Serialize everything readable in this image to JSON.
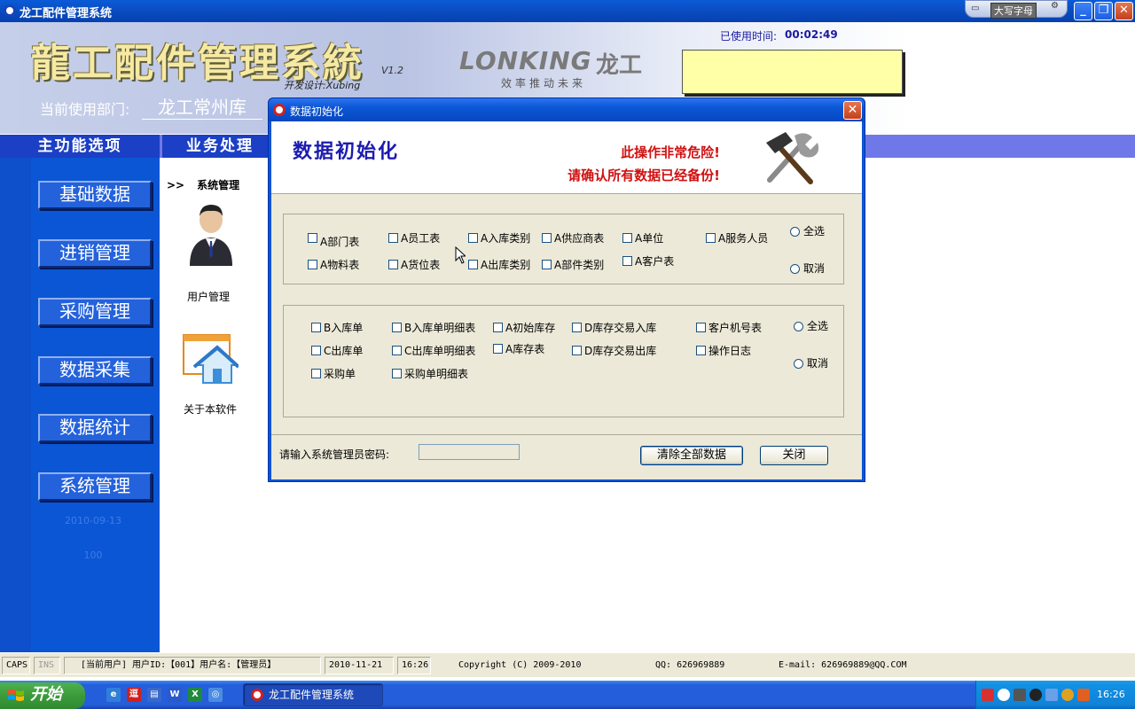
{
  "window": {
    "title": "龙工配件管理系统",
    "caps_indicator": "大写字母"
  },
  "banner": {
    "logo_title": "龍工配件管理系統",
    "version": "V1.2",
    "designer": "开发设计:Xubing",
    "brand": "LONKING",
    "brand_cn": "龙工",
    "slogan": "效率推动未来",
    "dept_label": "当前使用部门:",
    "dept_value": "龙工常州库",
    "usetime_label": "已使用时间:",
    "usetime_value": "00:02:49"
  },
  "tabs": {
    "main": "主功能选项",
    "business": "业务处理"
  },
  "sidebar": {
    "items": [
      {
        "label": "基础数据"
      },
      {
        "label": "进销管理"
      },
      {
        "label": "采购管理"
      },
      {
        "label": "数据采集"
      },
      {
        "label": "数据统计"
      },
      {
        "label": "系统管理"
      }
    ],
    "date": "2010-09-13",
    "number": "100"
  },
  "workspace": {
    "breadcrumb_arrow": ">>",
    "breadcrumb": "系统管理",
    "user_mgmt": "用户管理",
    "about": "关于本软件"
  },
  "dialog": {
    "title": "数据初始化",
    "heading": "数据初始化",
    "warning1": "此操作非常危险!",
    "warning2": "请确认所有数据已经备份!",
    "group1": {
      "row1": [
        "A部门表",
        "A员工表",
        "A入库类别",
        "A供应商表",
        "A单位",
        "A服务人员"
      ],
      "row2": [
        "A物料表",
        "A货位表",
        "A出库类别",
        "A部件类别",
        "A客户表"
      ],
      "select_all": "全选",
      "cancel": "取消"
    },
    "group2": {
      "row1": [
        "B入库单",
        "B入库单明细表",
        "A初始库存",
        "D库存交易入库",
        "客户机号表"
      ],
      "row2": [
        "C出库单",
        "C出库单明细表",
        "A库存表",
        "D库存交易出库",
        "操作日志"
      ],
      "row3": [
        "采购单",
        "采购单明细表"
      ],
      "select_all": "全选",
      "cancel": "取消"
    },
    "password_label": "请输入系统管理员密码:",
    "clear_button": "清除全部数据",
    "close_button": "关闭"
  },
  "statusbar": {
    "caps": "CAPS",
    "ins": "INS",
    "user_info": "[当前用户] 用户ID:【001】用户名:【管理员】",
    "date": "2010-11-21",
    "time": "16:26",
    "copyright": "Copyright  (C) 2009-2010",
    "qq": "QQ: 626969889",
    "email": "E-mail:  626969889@QQ.COM"
  },
  "taskbar": {
    "start": "开始",
    "task_item": "龙工配件管理系统",
    "clock": "16:26"
  },
  "colors": {
    "titlebar": "#0b4ec4",
    "sidebar": "#0b56d4",
    "warning": "#d01010",
    "heading": "#1b1bb0"
  }
}
